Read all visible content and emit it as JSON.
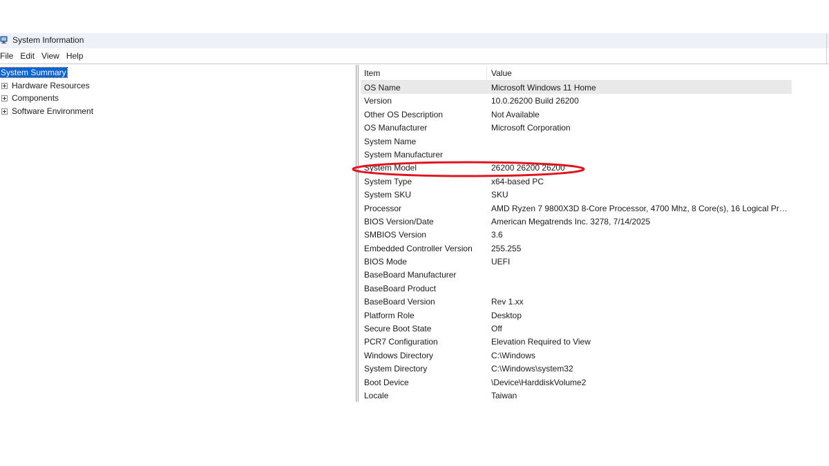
{
  "window": {
    "title": "System Information"
  },
  "menu": [
    "File",
    "Edit",
    "View",
    "Help"
  ],
  "tree": [
    {
      "label": "System Summary",
      "selected": true,
      "expandable": false
    },
    {
      "label": "Hardware Resources",
      "selected": false,
      "expandable": true
    },
    {
      "label": "Components",
      "selected": false,
      "expandable": true
    },
    {
      "label": "Software Environment",
      "selected": false,
      "expandable": true
    }
  ],
  "list": {
    "headers": {
      "item": "Item",
      "value": "Value"
    },
    "rows": [
      {
        "item": "OS Name",
        "value": "Microsoft Windows 11 Home"
      },
      {
        "item": "Version",
        "value": "10.0.26200 Build 26200"
      },
      {
        "item": "Other OS Description",
        "value": "Not Available"
      },
      {
        "item": "OS Manufacturer",
        "value": "Microsoft Corporation"
      },
      {
        "item": "System Name",
        "value": ""
      },
      {
        "item": "System Manufacturer",
        "value": ""
      },
      {
        "item": "System Model",
        "value": "26200  26200  26200"
      },
      {
        "item": "System Type",
        "value": "x64-based PC"
      },
      {
        "item": "System SKU",
        "value": "SKU"
      },
      {
        "item": "Processor",
        "value": "AMD Ryzen 7 9800X3D 8-Core Processor, 4700 Mhz, 8 Core(s), 16 Logical Pro..."
      },
      {
        "item": "BIOS Version/Date",
        "value": "American Megatrends Inc. 3278, 7/14/2025"
      },
      {
        "item": "SMBIOS Version",
        "value": "3.6"
      },
      {
        "item": "Embedded Controller Version",
        "value": "255.255"
      },
      {
        "item": "BIOS Mode",
        "value": "UEFI"
      },
      {
        "item": "BaseBoard Manufacturer",
        "value": ""
      },
      {
        "item": "BaseBoard Product",
        "value": ""
      },
      {
        "item": "BaseBoard Version",
        "value": "Rev 1.xx"
      },
      {
        "item": "Platform Role",
        "value": "Desktop"
      },
      {
        "item": "Secure Boot State",
        "value": "Off"
      },
      {
        "item": "PCR7 Configuration",
        "value": "Elevation Required to View"
      },
      {
        "item": "Windows Directory",
        "value": "C:\\Windows"
      },
      {
        "item": "System Directory",
        "value": "C:\\Windows\\system32"
      },
      {
        "item": "Boot Device",
        "value": "\\Device\\HarddiskVolume2"
      },
      {
        "item": "Locale",
        "value": "Taiwan"
      }
    ],
    "selected_row": 0
  },
  "annotation": {
    "color": "#e0141e",
    "marks_row": "System Model"
  },
  "colors": {
    "selection": "#0a64d6",
    "row_highlight": "#e9e9e9",
    "titlebar": "#eef2f8"
  }
}
